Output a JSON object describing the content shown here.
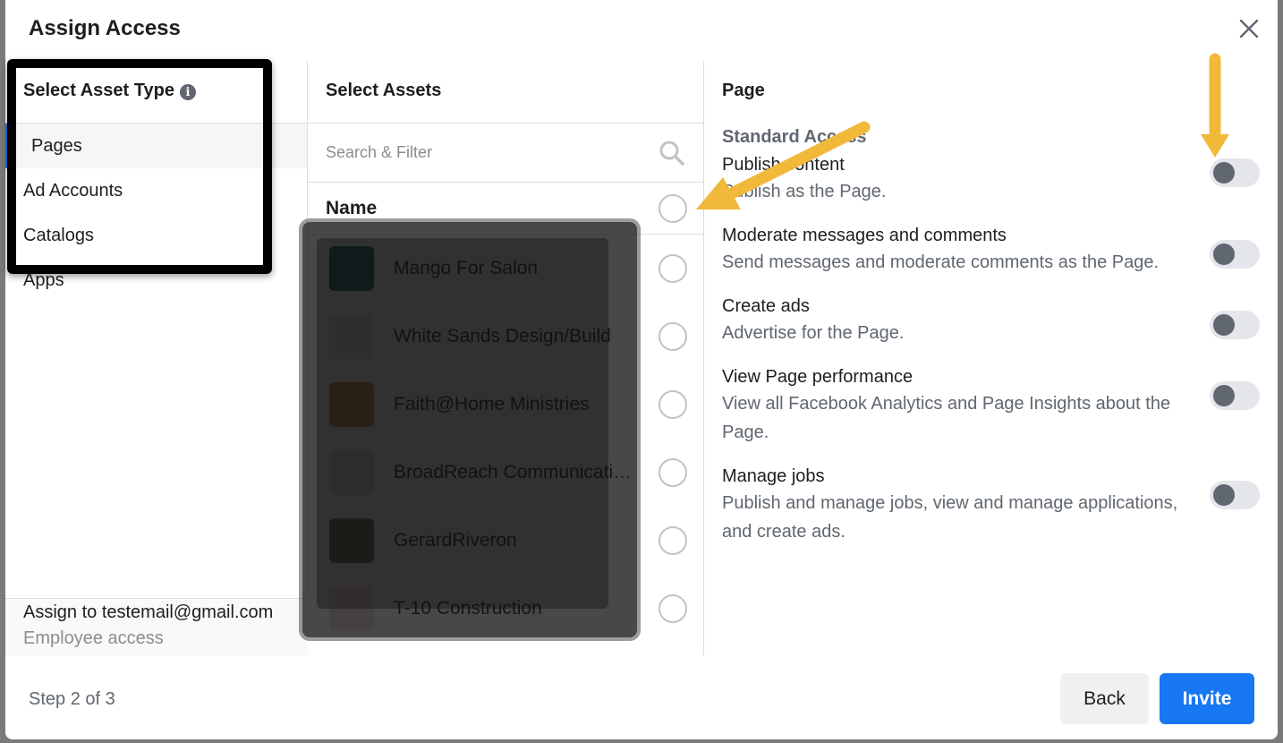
{
  "dialog": {
    "title": "Assign Access",
    "close_icon": "close-icon"
  },
  "asset_type": {
    "header": "Select Asset Type",
    "info_icon": "i",
    "items": [
      {
        "label": "Pages",
        "active": true
      },
      {
        "label": "Ad Accounts",
        "active": false
      },
      {
        "label": "Catalogs",
        "active": false
      },
      {
        "label": "Apps",
        "active": false
      }
    ],
    "assign_to": "Assign to testemail@gmail.com",
    "assign_role": "Employee access"
  },
  "assets": {
    "header": "Select Assets",
    "search_placeholder": "Search & Filter",
    "name_column": "Name",
    "rows": [
      {
        "name": "Mango For Salon",
        "thumb_color": "#0b5e6b"
      },
      {
        "name": "White Sands Design/Build",
        "thumb_color": "#e6e6e6"
      },
      {
        "name": "Faith@Home Ministries",
        "thumb_color": "#c9853a"
      },
      {
        "name": "BroadReach Communications",
        "thumb_color": "#e8d8d8"
      },
      {
        "name": "GerardRiveron",
        "thumb_color": "#6b6050"
      },
      {
        "name": "T-10 Construction",
        "thumb_color": "#f0e0d8"
      }
    ]
  },
  "permissions": {
    "header": "Page",
    "section": "Standard Access",
    "items": [
      {
        "title": "Publish content",
        "desc": "Publish as the Page.",
        "enabled": false
      },
      {
        "title": "Moderate messages and comments",
        "desc": "Send messages and moderate comments as the Page.",
        "enabled": false
      },
      {
        "title": "Create ads",
        "desc": "Advertise for the Page.",
        "enabled": false
      },
      {
        "title": "View Page performance",
        "desc": "View all Facebook Analytics and Page Insights about the Page.",
        "enabled": false
      },
      {
        "title": "Manage jobs",
        "desc": "Publish and manage jobs, view and manage applications, and create ads.",
        "enabled": false
      }
    ]
  },
  "footer": {
    "step": "Step 2 of 3",
    "back_label": "Back",
    "invite_label": "Invite"
  },
  "colors": {
    "accent": "#1877f2",
    "annotation_arrow": "#f0b93a"
  }
}
